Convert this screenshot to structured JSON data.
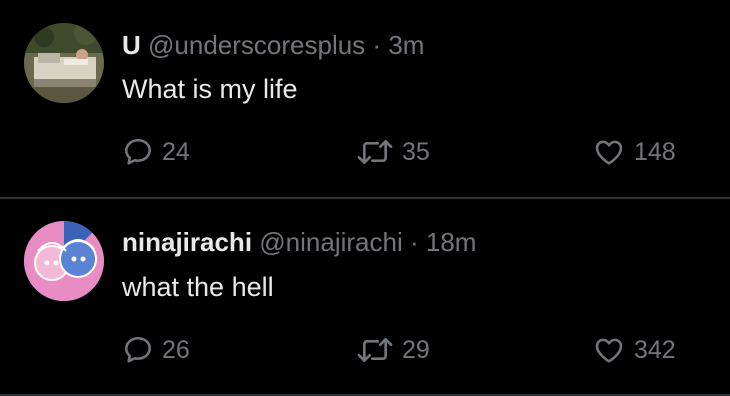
{
  "colors": {
    "background": "#000000",
    "primary_text": "#e7e9ea",
    "secondary_text": "#71767b",
    "divider": "#2f3336"
  },
  "tweets": [
    {
      "display_name": "U",
      "handle": "@underscoresplus",
      "separator": "·",
      "time": "3m",
      "text": "What is my life",
      "replies": "24",
      "retweets": "35",
      "likes": "148",
      "avatar_icon": "photo-avatar"
    },
    {
      "display_name": "ninajirachi",
      "handle": "@ninajirachi",
      "separator": "·",
      "time": "18m",
      "text": "what the hell",
      "replies": "26",
      "retweets": "29",
      "likes": "342",
      "avatar_icon": "illustrated-avatar"
    }
  ],
  "icons": {
    "reply": "reply-bubble-icon",
    "retweet": "retweet-arrows-icon",
    "like": "heart-icon"
  }
}
